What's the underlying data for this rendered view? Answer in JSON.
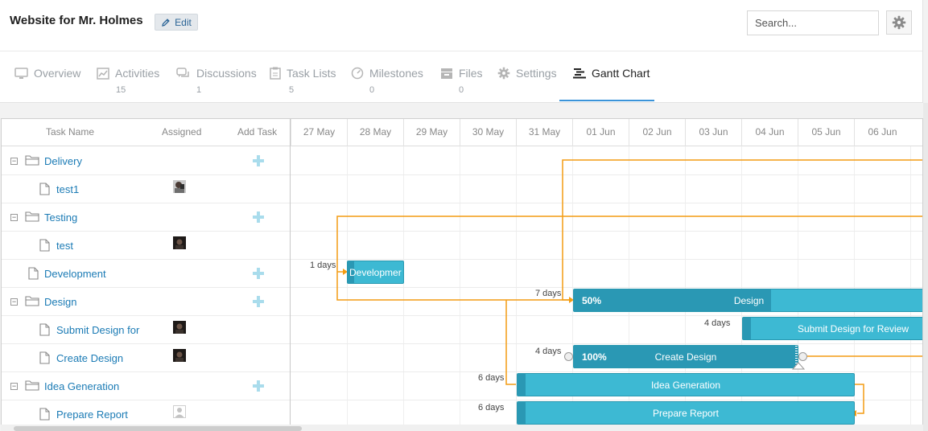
{
  "project": {
    "title": "Website for Mr. Holmes",
    "edit_label": "Edit"
  },
  "search": {
    "placeholder": "Search..."
  },
  "tabs": [
    {
      "label": "Overview",
      "count": "",
      "icon": "monitor-icon"
    },
    {
      "label": "Activities",
      "count": "15",
      "icon": "activity-chart-icon"
    },
    {
      "label": "Discussions",
      "count": "1",
      "icon": "discussion-bubbles-icon"
    },
    {
      "label": "Task Lists",
      "count": "5",
      "icon": "clipboard-icon"
    },
    {
      "label": "Milestones",
      "count": "0",
      "icon": "milestone-gauge-icon"
    },
    {
      "label": "Files",
      "count": "0",
      "icon": "file-tray-icon"
    },
    {
      "label": "Settings",
      "count": "",
      "icon": "gear-icon"
    },
    {
      "label": "Gantt Chart",
      "count": "",
      "icon": "gantt-icon",
      "active": true
    }
  ],
  "grid": {
    "columns": {
      "task_name": "Task Name",
      "assigned": "Assigned",
      "add_task": "Add Task"
    },
    "dates": [
      "27 May",
      "28 May",
      "29 May",
      "30 May",
      "31 May",
      "01 Jun",
      "02 Jun",
      "03 Jun",
      "04 Jun",
      "05 Jun",
      "06 Jun"
    ]
  },
  "rows": [
    {
      "name": "Delivery",
      "type": "group",
      "icon": "folder-icon",
      "add": true
    },
    {
      "name": "test1",
      "type": "task",
      "icon": "document-icon",
      "avatar": "photo"
    },
    {
      "name": "Testing",
      "type": "group",
      "icon": "folder-icon",
      "add": true
    },
    {
      "name": "test",
      "type": "task",
      "icon": "document-icon",
      "avatar": "dark"
    },
    {
      "name": "Development",
      "type": "task-top",
      "icon": "document-icon",
      "add": true
    },
    {
      "name": "Design",
      "type": "group",
      "icon": "folder-icon",
      "add": true
    },
    {
      "name": "Submit Design for",
      "type": "task",
      "icon": "document-icon",
      "avatar": "dark"
    },
    {
      "name": "Create Design",
      "type": "task",
      "icon": "document-icon",
      "avatar": "dark"
    },
    {
      "name": "Idea Generation",
      "type": "group",
      "icon": "folder-icon",
      "add": true
    },
    {
      "name": "Prepare Report",
      "type": "task",
      "icon": "document-icon",
      "avatar": "placeholder"
    }
  ],
  "bars": [
    {
      "label": "Developmer",
      "lag": "1 days",
      "row": 4
    },
    {
      "label": "Design",
      "progress_text": "50%",
      "progress": 0.5,
      "lag": "7 days",
      "row": 5
    },
    {
      "label": "Submit Design for Review",
      "lag": "4 days",
      "row": 6
    },
    {
      "label": "Create Design",
      "progress_text": "100%",
      "progress": 1.0,
      "lag": "4 days",
      "row": 7
    },
    {
      "label": "Idea Generation",
      "lag": "6 days",
      "row": 8
    },
    {
      "label": "Prepare Report",
      "lag": "6 days",
      "row": 9
    }
  ],
  "colors": {
    "accent": "#3b94d9",
    "bar": "#3db9d3",
    "bar_progress": "#2a98b4",
    "link": "#f39c12",
    "task_text": "#1b7bb5"
  }
}
